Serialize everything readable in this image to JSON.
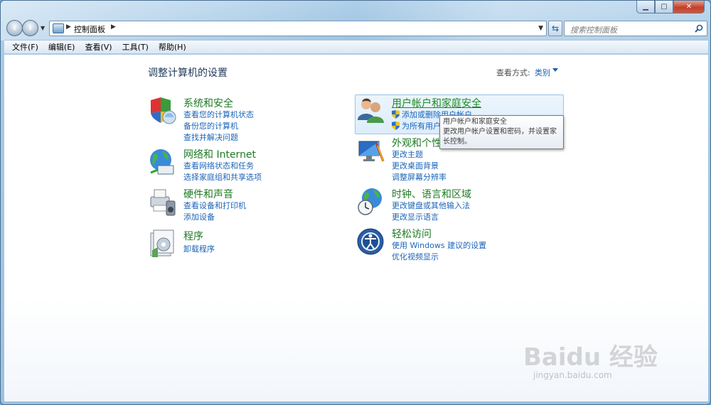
{
  "window": {
    "caption_min": "▁",
    "caption_max": "▢",
    "caption_close": "✕"
  },
  "address": {
    "path": "控制面板",
    "search_placeholder": "搜索控制面板"
  },
  "menu": [
    "文件(F)",
    "编辑(E)",
    "查看(V)",
    "工具(T)",
    "帮助(H)"
  ],
  "page": {
    "title": "调整计算机的设置",
    "view_by_label": "查看方式:",
    "view_by_value": "类别"
  },
  "categories": [
    {
      "title": "系统和安全",
      "icon": "system-security-icon",
      "links": [
        "查看您的计算机状态",
        "备份您的计算机",
        "查找并解决问题"
      ]
    },
    {
      "title": "网络和 Internet",
      "icon": "network-internet-icon",
      "links": [
        "查看网络状态和任务",
        "选择家庭组和共享选项"
      ]
    },
    {
      "title": "硬件和声音",
      "icon": "hardware-sound-icon",
      "links": [
        "查看设备和打印机",
        "添加设备"
      ]
    },
    {
      "title": "程序",
      "icon": "programs-icon",
      "links": [
        "卸载程序"
      ]
    },
    {
      "title": "用户帐户和家庭安全",
      "icon": "user-accounts-icon",
      "links": [
        "添加或删除用户帐户",
        "为所有用户"
      ]
    },
    {
      "title": "外观和个性",
      "icon": "appearance-icon",
      "links": [
        "更改主题",
        "更改桌面背景",
        "调整屏幕分辨率"
      ]
    },
    {
      "title": "时钟、语言和区域",
      "icon": "clock-language-icon",
      "links": [
        "更改键盘或其他输入法",
        "更改显示语言"
      ]
    },
    {
      "title": "轻松访问",
      "icon": "ease-of-access-icon",
      "links": [
        "使用 Windows 建议的设置",
        "优化视频显示"
      ]
    }
  ],
  "tooltip": {
    "line1": "用户帐户和家庭安全",
    "line2": "更改用户帐户设置和密码，并设置家",
    "line3": "长控制。"
  },
  "watermark": {
    "logo": "Baidu 经验",
    "url": "jingyan.baidu.com"
  }
}
